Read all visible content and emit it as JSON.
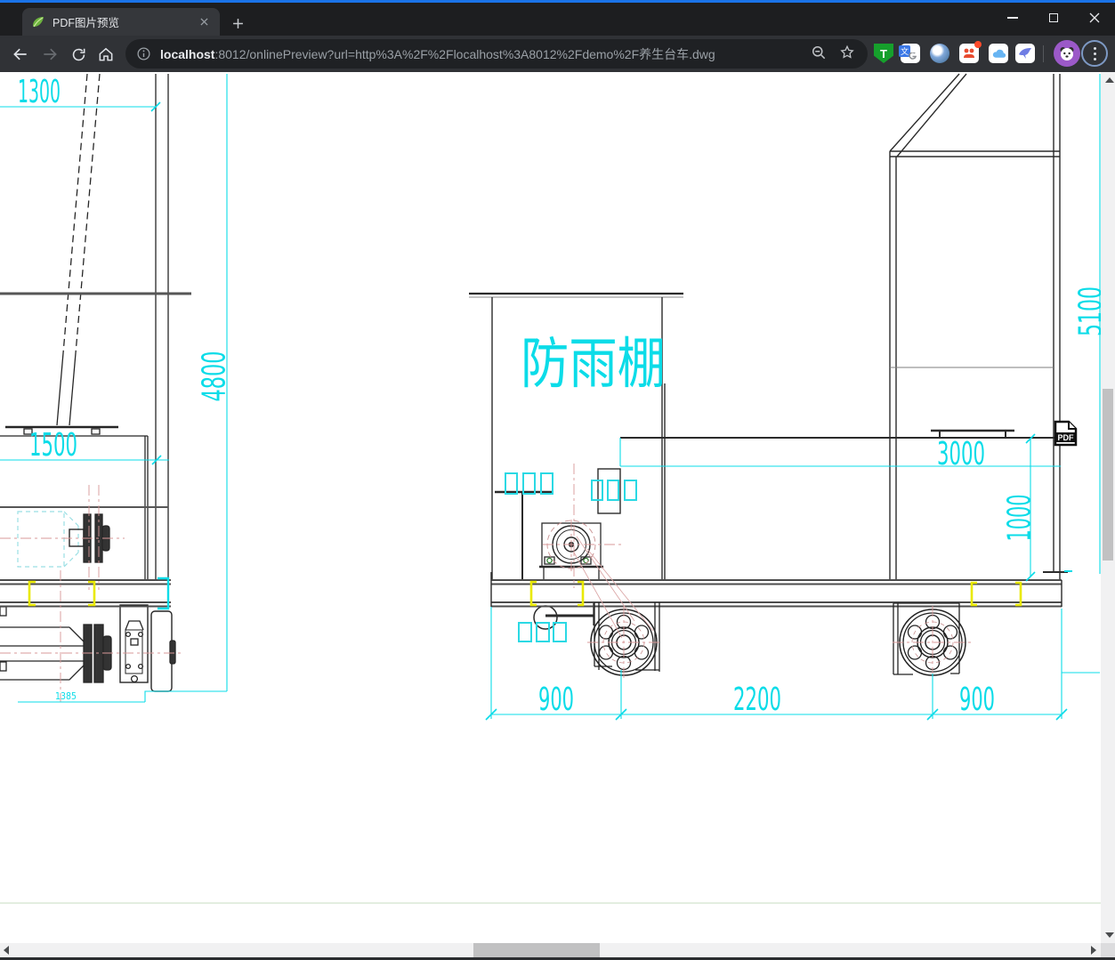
{
  "browser": {
    "tab_title": "PDF图片预览",
    "url_host": "localhost",
    "url_rest": ":8012/onlinePreview?url=http%3A%2F%2Flocalhost%3A8012%2Fdemo%2F养生台车.dwg"
  },
  "drawing": {
    "shelter_label": "防雨棚",
    "dim_top_width": "1300",
    "dim_left_height": "4800",
    "dim_hopper_width": "1500",
    "dim_axle_span": "1385",
    "dim_platform_length": "3000",
    "dim_platform_height": "1000",
    "dim_right_height": "5100",
    "dim_left_overhang": "900",
    "dim_wheelbase": "2200",
    "dim_right_overhang": "900",
    "pdf_badge_label": "PDF"
  },
  "icons": {
    "tampermonkey_letter": "T",
    "translate_letter": "文"
  },
  "colors": {
    "dimension_cyan": "#0bdce8",
    "clamp_yellow": "#e9e900",
    "centerline_pink": "#d89898",
    "accent_blue": "#1a73e8"
  }
}
